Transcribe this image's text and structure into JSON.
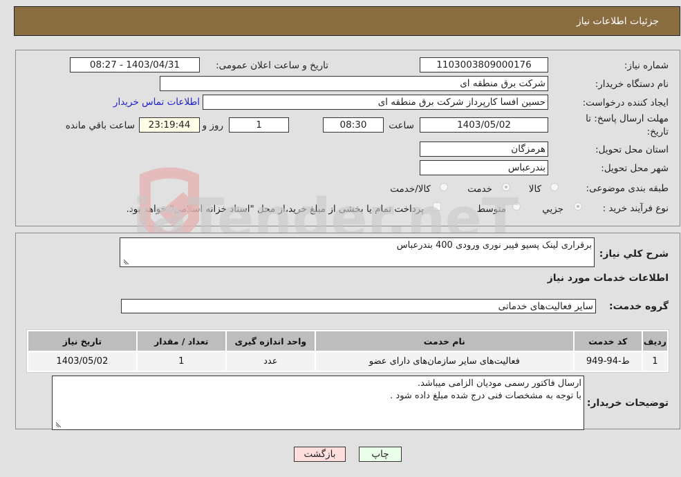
{
  "header": {
    "title": "جزئیات اطلاعات نیاز"
  },
  "form": {
    "need_number_label": "شماره نیاز:",
    "need_number": "1103003809000176",
    "announce_label": "تاریخ و ساعت اعلان عمومی:",
    "announce_value": "1403/04/31 - 08:27",
    "buyer_org_label": "نام دستگاه خریدار:",
    "buyer_org": "شرکت برق منطقه ای",
    "creator_label": "ایجاد کننده درخواست:",
    "creator": "حسین افسا کارپرداز شرکت برق منطقه ای",
    "contact_link": "اطلاعات تماس خریدار",
    "deadline_label": "مهلت ارسال پاسخ: تا تاریخ:",
    "deadline_date": "1403/05/02",
    "time_label": "ساعت",
    "deadline_time": "08:30",
    "days": "1",
    "days_label": "روز و",
    "remaining_time": "23:19:44",
    "remaining_label": "ساعت باقي مانده",
    "province_label": "استان محل تحویل:",
    "province": "هرمزگان",
    "city_label": "شهر محل تحویل:",
    "city": "بندرعباس",
    "category_label": "طبقه بندی موضوعی:",
    "category_options": [
      "کالا",
      "خدمت",
      "کالا/خدمت"
    ],
    "category_selected": "خدمت",
    "process_label": "نوع فرآیند خرید :",
    "process_options": [
      "جزيي",
      "متوسط"
    ],
    "payment_note": "پرداخت تمام یا بخشی از مبلغ خرید،از محل \"اسناد خزانه اسلامی\" خواهد بود."
  },
  "details": {
    "description_label": "شرح کلي نياز:",
    "description": "برقراری لینک پسیو فیبر نوری ورودی 400 بندرعباس",
    "services_heading": "اطلاعات خدمات مورد نیاز",
    "service_group_label": "گروه خدمت:",
    "service_group": "سایر فعالیت‌های خدماتی",
    "table": {
      "headers": [
        "ردیف",
        "کد خدمت",
        "نام خدمت",
        "واحد اندازه گیری",
        "تعداد / مقدار",
        "تاریخ نیاز"
      ],
      "rows": [
        [
          "1",
          "ط-94-949",
          "فعالیت‌های سایر سازمان‌های دارای عضو",
          "عدد",
          "1",
          "1403/05/02"
        ]
      ]
    },
    "buyer_notes_label": "توضیحات خریدار:",
    "buyer_notes_line1": "ارسال فاکتور رسمی مودیان الزامی میباشد.",
    "buyer_notes_line2": "با توجه به مشخصات فنی درج شده مبلغ داده شود ."
  },
  "buttons": {
    "print": "چاپ",
    "back": "بازگشت"
  },
  "watermark": {
    "text": "AriaTender.neT"
  },
  "colors": {
    "header_bg": "#8b6d42",
    "print_bg": "#eaffea",
    "back_bg": "#ffdede",
    "link": "#2020d0"
  }
}
